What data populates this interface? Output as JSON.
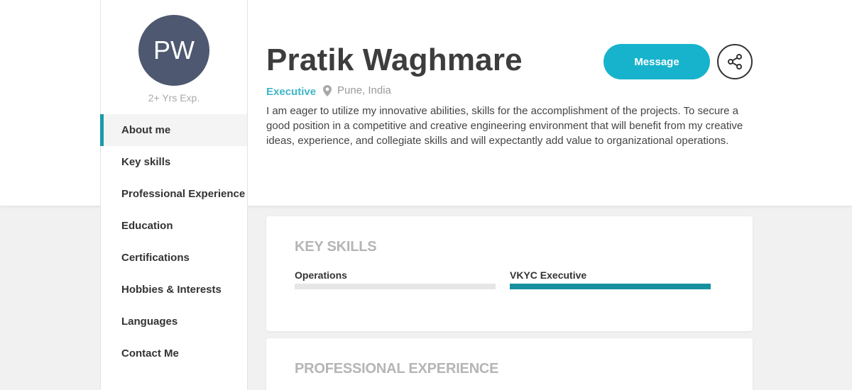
{
  "profile": {
    "initials": "PW",
    "experience": "2+ Yrs Exp.",
    "name": "Pratik Waghmare",
    "role": "Executive",
    "location": "Pune, India",
    "about": "I am eager to utilize my innovative abilities, skills for the accomplishment of the projects. To secure a good position in a competitive and creative engineering environment that will benefit from my creative ideas, experience, and collegiate skills and will expectantly add value to organizational operations."
  },
  "actions": {
    "message_label": "Message",
    "share_icon": "share-icon"
  },
  "nav": {
    "items": [
      {
        "label": "About me",
        "active": true
      },
      {
        "label": "Key skills",
        "active": false
      },
      {
        "label": "Professional Experience",
        "active": false
      },
      {
        "label": "Education",
        "active": false
      },
      {
        "label": "Certifications",
        "active": false
      },
      {
        "label": "Hobbies & Interests",
        "active": false
      },
      {
        "label": "Languages",
        "active": false
      },
      {
        "label": "Contact Me",
        "active": false
      }
    ]
  },
  "key_skills": {
    "title": "KEY SKILLS",
    "skills": [
      {
        "name": "Operations",
        "level": 0
      },
      {
        "name": "VKYC Executive",
        "level": 1
      }
    ]
  },
  "professional_experience": {
    "title": "PROFESSIONAL EXPERIENCE"
  },
  "colors": {
    "accent": "#17b3cd",
    "role_text": "#3fb6c7",
    "skill_bar": "#17919f",
    "avatar_bg": "#4e5870"
  }
}
